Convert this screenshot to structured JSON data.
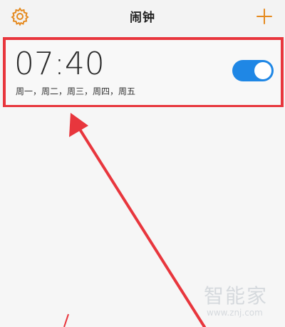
{
  "header": {
    "title": "闹钟",
    "settings_icon": "gear-icon",
    "add_icon": "plus-icon",
    "accent_color": "#e58a1f"
  },
  "alarms": [
    {
      "time": "07:40",
      "repeat": "周一，周二，周三，周四，周五",
      "enabled": true,
      "toggle_color": "#1f87e5"
    }
  ],
  "annotation": {
    "highlight_color": "#e8363d",
    "arrow_color": "#e8363d"
  },
  "watermark": {
    "brand": "智能家",
    "url": "www.znj.com"
  }
}
